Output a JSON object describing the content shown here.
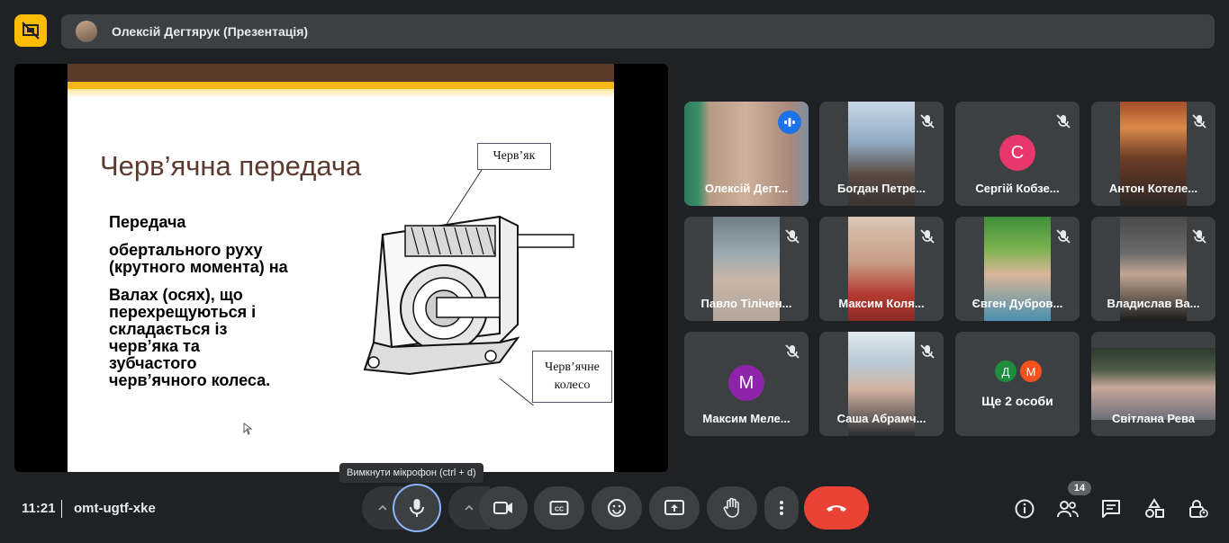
{
  "header": {
    "presenter_name": "Олексій Дегтярук (Презентація)"
  },
  "slide": {
    "title": "Черв’ячна передача",
    "paragraphs": [
      "Передача",
      "обертального руху",
      "(крутного момента) на",
      "Валах (осях),  що",
      "перехрещуються і",
      "складається із",
      "черв’яка та",
      "зубчастого",
      "черв’ячного колеса."
    ],
    "callout_worm": "Черв’як",
    "callout_wheel_line1": "Черв’ячне",
    "callout_wheel_line2": "колесо"
  },
  "participants": [
    {
      "name": "Олексій Дегт...",
      "speaking": true
    },
    {
      "name": "Богдан Петре...",
      "muted": true
    },
    {
      "name": "Сергій Кобзе...",
      "muted": true,
      "initial": "С",
      "color": "#e8376b"
    },
    {
      "name": "Антон Котеле...",
      "muted": true
    },
    {
      "name": "Павло Тілічен...",
      "muted": true
    },
    {
      "name": "Максим Коля...",
      "muted": true
    },
    {
      "name": "Євген Дубров...",
      "muted": true
    },
    {
      "name": "Владислав Ва...",
      "muted": true
    },
    {
      "name": "Максим Меле...",
      "muted": true,
      "initial": "M",
      "color": "#8e24aa"
    },
    {
      "name": "Саша Абрамч...",
      "muted": true
    },
    {
      "name": "Ще 2 особи",
      "initials": [
        "Д",
        "М"
      ],
      "colors": [
        "#1e8e3e",
        "#f4511e"
      ]
    },
    {
      "name": "Світлана Рева"
    }
  ],
  "footer": {
    "time": "11:21",
    "meeting_code": "omt-ugtf-xke",
    "mic_tooltip": "Вимкнути мікрофон (ctrl + d)",
    "people_count": "14"
  },
  "colors": {
    "leave_button": "#ea4335",
    "accent_blue": "#8ab4f8",
    "present_badge": "#fbbc04"
  }
}
